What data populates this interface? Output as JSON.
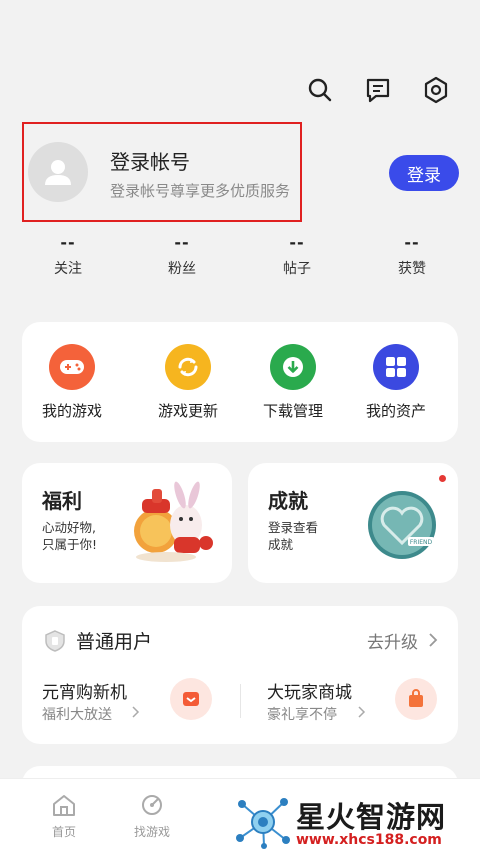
{
  "header": {
    "icons": [
      "search-icon",
      "message-icon",
      "settings-icon"
    ]
  },
  "profile": {
    "title": "登录帐号",
    "subtitle": "登录帐号尊享更多优质服务",
    "login_button": "登录"
  },
  "stats": [
    {
      "value": "--",
      "label": "关注"
    },
    {
      "value": "--",
      "label": "粉丝"
    },
    {
      "value": "--",
      "label": "帖子"
    },
    {
      "value": "--",
      "label": "获赞"
    }
  ],
  "quick_actions": [
    {
      "label": "我的游戏",
      "icon": "gamepad-icon",
      "color": "#f4623a"
    },
    {
      "label": "游戏更新",
      "icon": "refresh-icon",
      "color": "#f6b51f"
    },
    {
      "label": "下载管理",
      "icon": "download-icon",
      "color": "#2aaa4d"
    },
    {
      "label": "我的资产",
      "icon": "grid-icon",
      "color": "#3b49e0"
    }
  ],
  "welfare": {
    "title": "福利",
    "line1": "心动好物,",
    "line2": "只属于你!"
  },
  "achievement": {
    "title": "成就",
    "line1": "登录查看",
    "line2": "成就",
    "badge_text": "FRIEND"
  },
  "membership": {
    "title": "普通用户",
    "upgrade": "去升级",
    "promos": [
      {
        "title": "元宵购新机",
        "subtitle": "福利大放送"
      },
      {
        "title": "大玩家商城",
        "subtitle": "豪礼享不停"
      }
    ]
  },
  "nav": {
    "items": [
      {
        "label": "首页"
      },
      {
        "label": "找游戏"
      }
    ]
  },
  "watermark": {
    "title": "星火智游网",
    "url": "www.xhcs188.com"
  },
  "colors": {
    "accent": "#3a4bea",
    "highlight": "#e02020"
  }
}
